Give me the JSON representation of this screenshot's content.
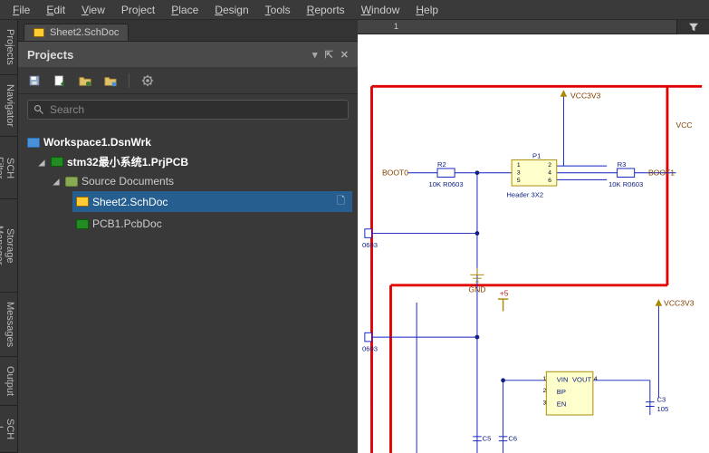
{
  "menus": [
    "File",
    "Edit",
    "View",
    "Project",
    "Place",
    "Design",
    "Tools",
    "Reports",
    "Window",
    "Help"
  ],
  "vtabs": [
    "Projects",
    "Navigator",
    "SCH Filter",
    "Storage Manager",
    "Messages",
    "Output",
    "SCH L"
  ],
  "doc_tab": "Sheet2.SchDoc",
  "panel_title": "Projects",
  "search_placeholder": "Search",
  "tree": {
    "workspace": "Workspace1.DsnWrk",
    "project": "stm32最小系统1.PrjPCB",
    "folder": "Source Documents",
    "sheet2": "Sheet2.SchDoc",
    "pcb1": "PCB1.PcbDoc"
  },
  "ruler_num": "1",
  "schematic": {
    "vcc3v3_top": "VCC3V3",
    "vcc_right": "VCC",
    "boot0": "BOOT0",
    "boot1": "BOOT1",
    "r2": "R2",
    "r3": "R3",
    "rval": "10K R0603",
    "p1": "P1",
    "header": "Header 3X2",
    "gnd": "GND",
    "plus5": "+5",
    "vcc3v3_br": "VCC3V3",
    "vin": "VIN",
    "vout": "VOUT",
    "bp": "BP",
    "en": "EN",
    "r0603a": "0603",
    "r0603b": "0603",
    "c5": "C5",
    "c6": "C6",
    "c3": "C3",
    "p1_1": "1",
    "p1_2": "2",
    "p1_3": "3",
    "p1_4": "4",
    "p1_5": "5",
    "p1_6": "6",
    "u_1": "1",
    "u_2": "2",
    "u_3": "3",
    "u_4": "4",
    "n105": "105"
  }
}
